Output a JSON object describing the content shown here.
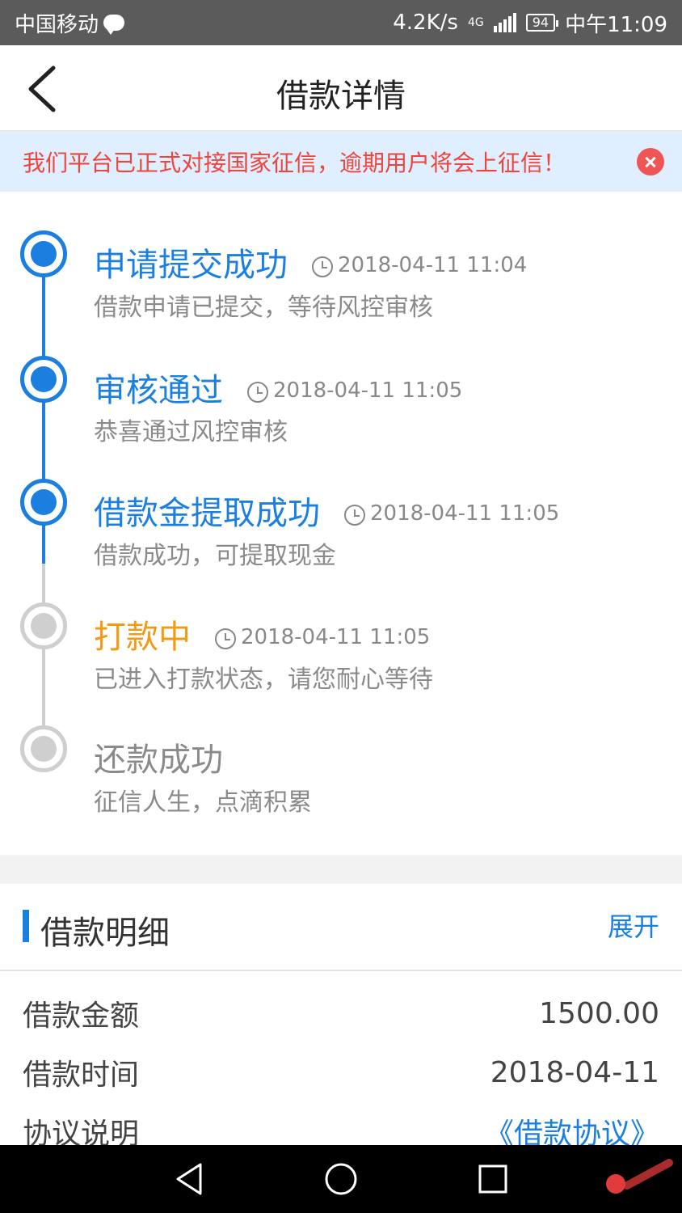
{
  "status_bar": {
    "carrier": "中国移动",
    "speed": "4.2K/s",
    "network": "4G",
    "battery": "94",
    "time": "中午11:09"
  },
  "nav": {
    "title": "借款详情"
  },
  "notice": {
    "text": "我们平台已正式对接国家征信，逾期用户将会上征信！"
  },
  "timeline": {
    "steps": [
      {
        "title": "申请提交成功",
        "time": "2018-04-11 11:04",
        "desc": "借款申请已提交，等待风控审核",
        "state": "done"
      },
      {
        "title": "审核通过",
        "time": "2018-04-11 11:05",
        "desc": "恭喜通过风控审核",
        "state": "done"
      },
      {
        "title": "借款金提取成功",
        "time": "2018-04-11 11:05",
        "desc": "借款成功，可提取现金",
        "state": "done"
      },
      {
        "title": "打款中",
        "time": "2018-04-11 11:05",
        "desc": "已进入打款状态，请您耐心等待",
        "state": "current"
      },
      {
        "title": "还款成功",
        "time": "",
        "desc": "征信人生，点滴积累",
        "state": "pending"
      }
    ]
  },
  "detail": {
    "section_title": "借款明细",
    "expand_label": "展开",
    "rows": [
      {
        "label": "借款金额",
        "value": "1500.00"
      },
      {
        "label": "借款时间",
        "value": "2018-04-11"
      },
      {
        "label": "协议说明",
        "value": "《借款协议》"
      }
    ]
  },
  "colors": {
    "accent_blue": "#1b7fe0",
    "current_orange": "#f29a14",
    "notice_red": "#f0433a",
    "notice_bg": "#e0efff"
  }
}
